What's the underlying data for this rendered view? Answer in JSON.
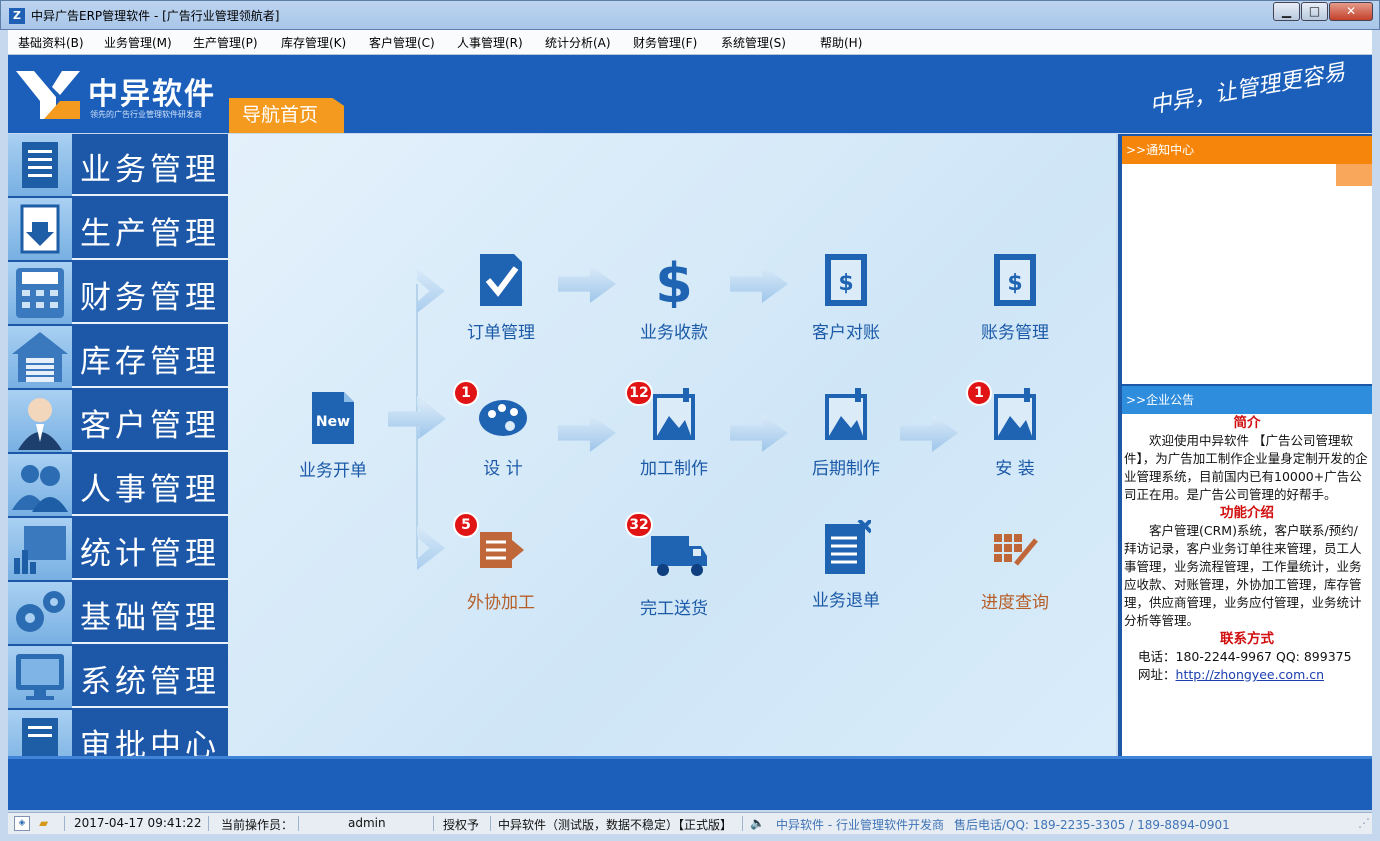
{
  "window": {
    "title": "中异广告ERP管理软件 - [广告行业管理领航者]",
    "app_icon": "Z",
    "minimize": "▁",
    "maximize": "□",
    "close": "✕"
  },
  "menu": [
    "基础资料(B)",
    "业务管理(M)",
    "生产管理(P)",
    "库存管理(K)",
    "客户管理(C)",
    "人事管理(R)",
    "统计分析(A)",
    "财务管理(F)",
    "系统管理(S)",
    "帮助(H)"
  ],
  "banner": {
    "logo_text": "中异软件",
    "logo_subtitle": "领先的广告行业管理软件研发商",
    "nav_tab": "导航首页",
    "slogan": "中异，让管理更容易"
  },
  "sidebar": [
    {
      "label": "业务管理",
      "icon": "clipboard-icon"
    },
    {
      "label": "生产管理",
      "icon": "production-icon"
    },
    {
      "label": "财务管理",
      "icon": "calculator-icon"
    },
    {
      "label": "库存管理",
      "icon": "warehouse-icon"
    },
    {
      "label": "客户管理",
      "icon": "customer-icon"
    },
    {
      "label": "人事管理",
      "icon": "people-icon"
    },
    {
      "label": "统计管理",
      "icon": "chart-icon"
    },
    {
      "label": "基础管理",
      "icon": "gears-icon"
    },
    {
      "label": "系统管理",
      "icon": "monitor-icon"
    },
    {
      "label": "审批中心",
      "icon": "approval-icon"
    }
  ],
  "flow": {
    "start": {
      "label": "业务开单",
      "icon_text": "New"
    },
    "row1": [
      {
        "label": "订单管理",
        "icon": "order-check-icon"
      },
      {
        "label": "业务收款",
        "icon": "dollar-icon"
      },
      {
        "label": "客户对账",
        "icon": "reconcile-icon"
      },
      {
        "label": "账务管理",
        "icon": "ledger-icon"
      }
    ],
    "row2": [
      {
        "label": "设  计",
        "icon": "palette-icon",
        "badge": "1"
      },
      {
        "label": "加工制作",
        "icon": "processing-icon",
        "badge": "12"
      },
      {
        "label": "后期制作",
        "icon": "postproduction-icon"
      },
      {
        "label": "安  装",
        "icon": "install-icon",
        "badge": "1"
      }
    ],
    "row3": [
      {
        "label": "外协加工",
        "icon": "outsource-icon",
        "badge": "5"
      },
      {
        "label": "完工送货",
        "icon": "truck-icon",
        "badge": "32"
      },
      {
        "label": "业务退单",
        "icon": "cancel-order-icon"
      },
      {
        "label": "进度查询",
        "icon": "progress-query-icon"
      }
    ]
  },
  "right_panel": {
    "notice_title": ">>通知中心",
    "announce_title": ">>企业公告",
    "intro_heading": "简介",
    "intro_text": "欢迎使用中异软件 【广告公司管理软件】，为广告加工制作企业量身定制开发的企业管理系统，目前国内已有10000+广告公司正在用。是广告公司管理的好帮手。",
    "features_heading": "功能介绍",
    "features_text": "客户管理(CRM)系统，客户联系/预约/拜访记录，客户业务订单往来管理，员工人事管理，业务流程管理，工作量统计，业务应收款、对账管理，外协加工管理，库存管理，供应商管理，业务应付管理，业务统计分析等管理。",
    "contact_heading": "联系方式",
    "phone_line": "电话：180-2244-9967  QQ: 899375",
    "website_label": "网址：",
    "website_url": "http://zhongyee.com.cn"
  },
  "statusbar": {
    "datetime": "2017-04-17 09:41:22",
    "operator_label": "当前操作员：",
    "operator": "admin",
    "license_label": "授权予",
    "edition": "中异软件（测试版，数据不稳定）【正式版】",
    "company": "中异软件 - 行业管理软件开发商",
    "hotline": "售后电话/QQ: 189-2235-3305  / 189-8894-0901"
  }
}
